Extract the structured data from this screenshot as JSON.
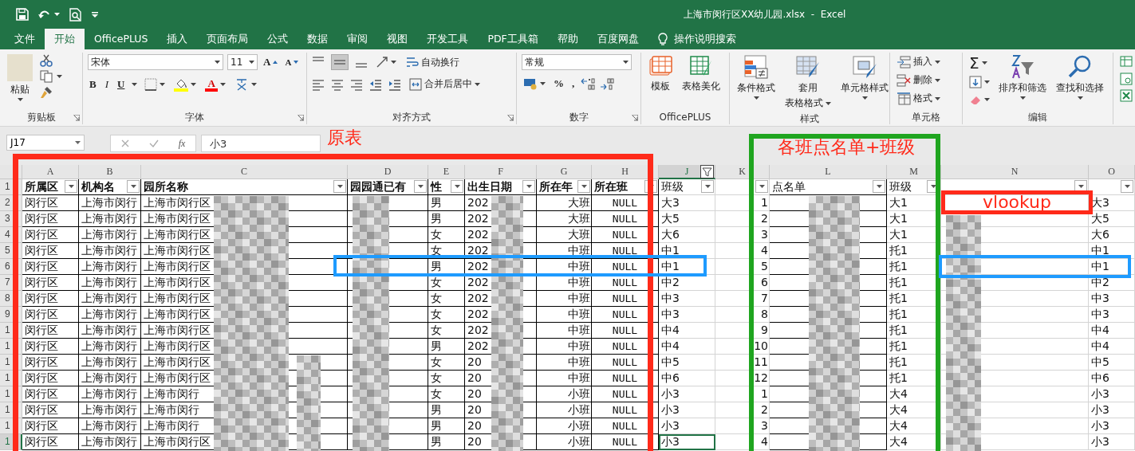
{
  "title_bar": {
    "title": "上海市闵行区XX幼儿园.xlsx  -  Excel"
  },
  "tabs": [
    {
      "label": "文件",
      "selected": false
    },
    {
      "label": "开始",
      "selected": true
    },
    {
      "label": "OfficePLUS",
      "selected": false
    },
    {
      "label": "插入",
      "selected": false
    },
    {
      "label": "页面布局",
      "selected": false
    },
    {
      "label": "公式",
      "selected": false
    },
    {
      "label": "数据",
      "selected": false
    },
    {
      "label": "审阅",
      "selected": false
    },
    {
      "label": "视图",
      "selected": false
    },
    {
      "label": "开发工具",
      "selected": false
    },
    {
      "label": "PDF工具箱",
      "selected": false
    },
    {
      "label": "帮助",
      "selected": false
    },
    {
      "label": "百度网盘",
      "selected": false
    }
  ],
  "tell_me": "操作说明搜索",
  "ribbon": {
    "clipboard": {
      "paste": "粘贴",
      "label": "剪贴板"
    },
    "font": {
      "font_name": "宋体",
      "font_size": "11",
      "grow": "A",
      "shrink": "A",
      "bold": "B",
      "italic": "I",
      "underline": "U",
      "font_color": "A",
      "label": "字体"
    },
    "alignment": {
      "wrap": "自动换行",
      "merge": "合并后居中",
      "label": "对齐方式"
    },
    "number": {
      "format": "常规",
      "percent": "%",
      "comma": ",",
      "label": "数字"
    },
    "officeplus": {
      "template": "模板",
      "beautify": "表格美化",
      "label": "OfficePLUS"
    },
    "styles": {
      "conditional": "条件格式",
      "table_format_line1": "套用",
      "table_format_line2": "表格格式",
      "cell_styles": "单元格样式",
      "label": "样式"
    },
    "cells": {
      "insert": "插入",
      "delete": "删除",
      "format": "格式",
      "label": "单元格"
    },
    "editing": {
      "sum": "Σ",
      "sort": "排序和筛选",
      "find": "查找和选择",
      "label": "编辑"
    }
  },
  "name_box": "J17",
  "fx": "fx",
  "formula": "小3",
  "sheet": {
    "columns": [
      {
        "letter": "A",
        "selected": false,
        "filtered": false
      },
      {
        "letter": "B",
        "selected": false,
        "filtered": false
      },
      {
        "letter": "C",
        "selected": false,
        "filtered": false
      },
      {
        "letter": "D",
        "selected": false,
        "filtered": false
      },
      {
        "letter": "E",
        "selected": false,
        "filtered": false
      },
      {
        "letter": "F",
        "selected": false,
        "filtered": false
      },
      {
        "letter": "G",
        "selected": false,
        "filtered": false
      },
      {
        "letter": "H",
        "selected": false,
        "filtered": false
      },
      {
        "letter": "J",
        "selected": true,
        "filtered": true
      },
      {
        "letter": "K",
        "selected": false,
        "filtered": false
      },
      {
        "letter": "L",
        "selected": false,
        "filtered": false
      },
      {
        "letter": "M",
        "selected": false,
        "filtered": false
      },
      {
        "letter": "N",
        "selected": false,
        "filtered": false
      },
      {
        "letter": "O",
        "selected": false,
        "filtered": false
      }
    ],
    "rows": [
      {
        "number": "1",
        "selected": false,
        "cells": {
          "A": "所属区",
          "B": "机构名",
          "C": "园所名称",
          "D": "园园通已有",
          "E": "性",
          "F": "出生日期",
          "G": "所在年",
          "H": "所在班",
          "J": "班级",
          "L": "点名单",
          "M": "班级"
        }
      },
      {
        "number": "2",
        "selected": false,
        "cells": {
          "A": "闵行区",
          "B": "上海市闵行",
          "C": "上海市闵行区",
          "E": "男",
          "F": "202",
          "G": "大班",
          "H": "NULL",
          "J": "大3",
          "K": "1",
          "M": "大1",
          "O": "大3"
        }
      },
      {
        "number": "3",
        "selected": false,
        "cells": {
          "A": "闵行区",
          "B": "上海市闵行",
          "C": "上海市闵行区",
          "E": "男",
          "F": "202",
          "G": "大班",
          "H": "NULL",
          "J": "大5",
          "K": "2",
          "M": "大1",
          "O": "大5"
        }
      },
      {
        "number": "4",
        "selected": false,
        "cells": {
          "A": "闵行区",
          "B": "上海市闵行",
          "C": "上海市闵行区",
          "E": "女",
          "F": "202",
          "G": "大班",
          "H": "NULL",
          "J": "大6",
          "K": "3",
          "M": "大1",
          "O": "大6"
        }
      },
      {
        "number": "5",
        "selected": false,
        "cells": {
          "A": "闵行区",
          "B": "上海市闵行",
          "C": "上海市闵行区",
          "E": "女",
          "F": "202",
          "G": "中班",
          "H": "NULL",
          "J": "中1",
          "K": "4",
          "M": "托1",
          "O": "中1"
        }
      },
      {
        "number": "6",
        "selected": false,
        "cells": {
          "A": "闵行区",
          "B": "上海市闵行",
          "C": "上海市闵行区",
          "E": "男",
          "F": "202",
          "G": "中班",
          "H": "NULL",
          "J": "中1",
          "K": "5",
          "M": "托1",
          "O": "中1"
        }
      },
      {
        "number": "7",
        "selected": false,
        "cells": {
          "A": "闵行区",
          "B": "上海市闵行",
          "C": "上海市闵行区",
          "E": "女",
          "F": "202",
          "G": "中班",
          "H": "NULL",
          "J": "中2",
          "K": "6",
          "M": "托1",
          "O": "中2"
        }
      },
      {
        "number": "8",
        "selected": false,
        "cells": {
          "A": "闵行区",
          "B": "上海市闵行",
          "C": "上海市闵行区",
          "E": "女",
          "F": "202",
          "G": "中班",
          "H": "NULL",
          "J": "中3",
          "K": "7",
          "M": "托1",
          "O": "中3"
        }
      },
      {
        "number": "9",
        "selected": false,
        "cells": {
          "A": "闵行区",
          "B": "上海市闵行",
          "C": "上海市闵行区",
          "E": "女",
          "F": "202",
          "G": "中班",
          "H": "NULL",
          "J": "中3",
          "K": "8",
          "M": "托1",
          "O": "中3"
        }
      },
      {
        "number": "1",
        "selected": false,
        "cells": {
          "A": "闵行区",
          "B": "上海市闵行",
          "C": "上海市闵行区",
          "E": "女",
          "F": "202",
          "G": "中班",
          "H": "NULL",
          "J": "中4",
          "K": "9",
          "M": "托1",
          "O": "中4"
        }
      },
      {
        "number": "1",
        "selected": false,
        "cells": {
          "A": "闵行区",
          "B": "上海市闵行",
          "C": "上海市闵行区",
          "E": "男",
          "F": "202",
          "G": "中班",
          "H": "NULL",
          "J": "中4",
          "K": "10",
          "M": "托1",
          "O": "中4"
        }
      },
      {
        "number": "1",
        "selected": false,
        "cells": {
          "A": "闵行区",
          "B": "上海市闵行",
          "C": "上海市闵行区",
          "E": "女",
          "F": "20",
          "G": "中班",
          "H": "NULL",
          "J": "中5",
          "K": "11",
          "M": "托1",
          "O": "中5"
        }
      },
      {
        "number": "1",
        "selected": false,
        "cells": {
          "A": "闵行区",
          "B": "上海市闵行",
          "C": "上海市闵行区",
          "E": "女",
          "F": "20",
          "G": "中班",
          "H": "NULL",
          "J": "中6",
          "K": "12",
          "M": "托1",
          "O": "中6"
        }
      },
      {
        "number": "1",
        "selected": false,
        "cells": {
          "A": "闵行区",
          "B": "上海市闵行",
          "C": "上海市闵行",
          "E": "女",
          "F": "20",
          "G": "小班",
          "H": "NULL",
          "J": "小3",
          "K": "1",
          "M": "大4",
          "O": "小3"
        }
      },
      {
        "number": "1",
        "selected": false,
        "cells": {
          "A": "闵行区",
          "B": "上海市闵行",
          "C": "上海市闵行",
          "E": "男",
          "F": "20",
          "G": "小班",
          "H": "NULL",
          "J": "小3",
          "K": "2",
          "M": "大4",
          "O": "小3"
        }
      },
      {
        "number": "1",
        "selected": false,
        "cells": {
          "A": "闵行区",
          "B": "上海市闵行",
          "C": "上海市闵行",
          "E": "男",
          "F": "20",
          "G": "小班",
          "H": "NULL",
          "J": "小3",
          "K": "3",
          "M": "大4",
          "O": "小3"
        }
      },
      {
        "number": "1",
        "selected": true,
        "cells": {
          "A": "闵行区",
          "B": "上海市闵行",
          "C": "上海市闵行区",
          "E": "男",
          "F": "20",
          "G": "小班",
          "H": "NULL",
          "J": "小3",
          "K": "4",
          "M": "大4",
          "O": "小3"
        }
      }
    ]
  },
  "annotations": [
    {
      "kind": "frame",
      "color": "#ff2a1a",
      "label": "原表"
    },
    {
      "kind": "frame",
      "color": "#1fa51f",
      "label": "各班点名单+班级"
    },
    {
      "kind": "frame",
      "color": "#1e9bff"
    },
    {
      "kind": "frame",
      "color": "#1e9bff"
    },
    {
      "kind": "frame",
      "color": "#ff2a1a",
      "label": "vlookup"
    }
  ]
}
